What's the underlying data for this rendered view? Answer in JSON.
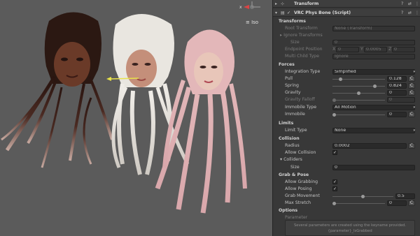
{
  "scene": {
    "iso_label": "≡ Iso",
    "axis_x": "x"
  },
  "transform_header": {
    "title": "Transform"
  },
  "component_header": {
    "title": "VRC Phys Bone (Script)",
    "enabled": true
  },
  "sections": {
    "transforms": "Transforms",
    "forces": "Forces",
    "limits": "Limits",
    "collision": "Collision",
    "grab_pose": "Grab & Pose",
    "options": "Options"
  },
  "fields": {
    "root_transform": {
      "label": "Root Transform",
      "value": "None (Transform)"
    },
    "ignore_transforms": {
      "label": "Ignore Transforms"
    },
    "ignore_size": {
      "label": "Size",
      "value": "0"
    },
    "endpoint_position": {
      "label": "Endpoint Position",
      "x": "0",
      "y": "0.0005",
      "z": "0"
    },
    "multi_child_type": {
      "label": "Multi Child Type",
      "value": "Ignore"
    },
    "integration_type": {
      "label": "Integration Type",
      "value": "Simplified"
    },
    "pull": {
      "label": "Pull",
      "value": "0.128",
      "level": 0.128
    },
    "spring": {
      "label": "Spring",
      "value": "0.824",
      "level": 0.824
    },
    "gravity": {
      "label": "Gravity",
      "value": "0",
      "level": 0.5
    },
    "gravity_falloff": {
      "label": "Gravity Falloff",
      "value": "0",
      "level": 0
    },
    "immobile_type": {
      "label": "Immobile Type",
      "value": "All Motion"
    },
    "immobile": {
      "label": "Immobile",
      "value": "0",
      "level": 0
    },
    "limit_type": {
      "label": "Limit Type",
      "value": "None"
    },
    "radius": {
      "label": "Radius",
      "value": "0.0002"
    },
    "allow_collision": {
      "label": "Allow Collision",
      "checked": true
    },
    "colliders": {
      "label": "Colliders"
    },
    "colliders_size": {
      "label": "Size",
      "value": "0"
    },
    "allow_grabbing": {
      "label": "Allow Grabbing",
      "checked": true
    },
    "allow_posing": {
      "label": "Allow Posing",
      "checked": true
    },
    "grab_movement": {
      "label": "Grab Movement",
      "value": "0.5",
      "level": 0.5
    },
    "max_stretch": {
      "label": "Max Stretch",
      "value": "0",
      "level": 0
    },
    "parameter": {
      "label": "Parameter"
    }
  },
  "curve_button": "C",
  "axis_labels": {
    "x": "X",
    "y": "Y",
    "z": "Z"
  },
  "help": {
    "line1": "Several parameters are created using the keyname provided.",
    "line2": "{parameter}_IsGrabbed"
  },
  "colors": {
    "accent": "#d44",
    "scene_bg": "#5b5b5b",
    "panel_bg": "#383838"
  }
}
